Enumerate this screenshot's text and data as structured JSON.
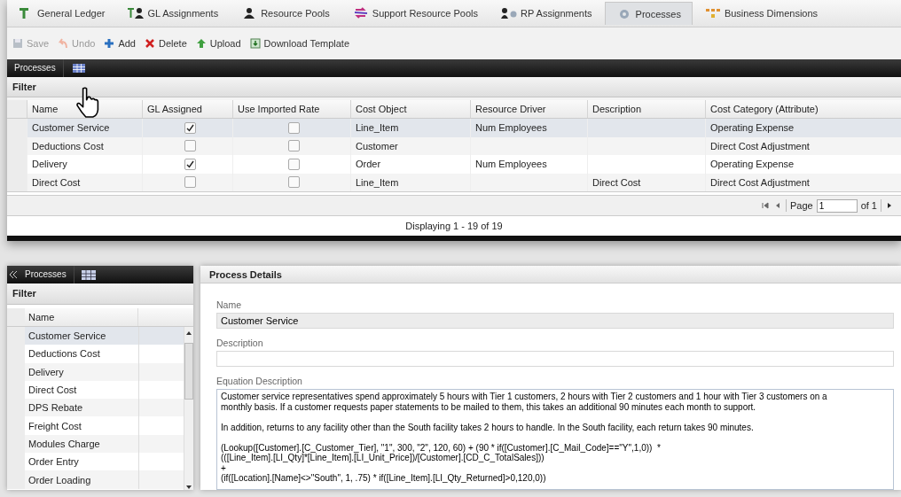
{
  "tabs": [
    {
      "label": "General Ledger",
      "selected": false
    },
    {
      "label": "GL Assignments",
      "selected": false
    },
    {
      "label": "Resource Pools",
      "selected": false
    },
    {
      "label": "Support Resource Pools",
      "selected": false
    },
    {
      "label": "RP Assignments",
      "selected": false
    },
    {
      "label": "Processes",
      "selected": true
    },
    {
      "label": "Business Dimensions",
      "selected": false
    }
  ],
  "toolbar": [
    {
      "label": "Save",
      "disabled": true
    },
    {
      "label": "Undo",
      "disabled": true
    },
    {
      "label": "Add",
      "disabled": false
    },
    {
      "label": "Delete",
      "disabled": false
    },
    {
      "label": "Upload",
      "disabled": false
    },
    {
      "label": "Download Template",
      "disabled": false
    }
  ],
  "grid": {
    "title": "Processes",
    "filter": "Filter",
    "columns": [
      "Name",
      "GL Assigned",
      "Use Imported Rate",
      "Cost Object",
      "Resource Driver",
      "Description",
      "Cost Category (Attribute)"
    ],
    "rows": [
      {
        "name": "Customer Service",
        "gl_assigned": true,
        "use_imported_rate": false,
        "cost_object": "Line_Item",
        "resource_driver": "Num Employees",
        "cost_category": "Operating Expense",
        "selected": true
      },
      {
        "name": "Deductions Cost",
        "gl_assigned": false,
        "use_imported_rate": false,
        "cost_object": "Customer",
        "cost_category": "Direct Cost Adjustment",
        "selected": false
      },
      {
        "name": "Delivery",
        "gl_assigned": true,
        "use_imported_rate": false,
        "cost_object": "Order",
        "resource_driver": "Num Employees",
        "cost_category": "Operating Expense",
        "selected": false
      },
      {
        "name": "Direct Cost",
        "gl_assigned": false,
        "use_imported_rate": false,
        "cost_object": "Line_Item",
        "description": "Direct Cost",
        "cost_category": "Direct Cost Adjustment",
        "selected": false
      }
    ],
    "pager": {
      "page_label": "Page",
      "page": "1",
      "of": "of 1"
    },
    "status": "Displaying 1 - 19 of 19"
  },
  "list": {
    "title": "Processes",
    "filter": "Filter",
    "column": "Name",
    "items": [
      {
        "name": "Customer Service",
        "selected": true
      },
      {
        "name": "Deductions Cost",
        "selected": false
      },
      {
        "name": "Delivery",
        "selected": false
      },
      {
        "name": "Direct Cost",
        "selected": false
      },
      {
        "name": "DPS Rebate",
        "selected": false
      },
      {
        "name": "Freight Cost",
        "selected": false
      },
      {
        "name": "Modules Charge",
        "selected": false
      },
      {
        "name": "Order Entry",
        "selected": false
      },
      {
        "name": "Order Loading",
        "selected": false
      }
    ]
  },
  "details": {
    "title": "Process Details",
    "fields": [
      {
        "label": "Name",
        "value": "Customer Service",
        "disabled": true,
        "kind": "line"
      },
      {
        "label": "Description",
        "disabled": false,
        "kind": "line"
      },
      {
        "label": "Equation Description",
        "value": "Customer service representatives spend approximately 5 hours with Tier 1 customers, 2 hours with Tier 2 customers and 1 hour with Tier 3 customers on a monthly basis. If a customer requests paper statements to be mailed to them, this takes an additional 90 minutes each month to support.\n\nIn addition, returns to any facility other than the South facility takes 2 hours to handle. In the South facility, each return takes 90 minutes.\n\n(Lookup([Customer].[C_Customer_Tier], \"1\", 300, \"2\", 120, 60) + (90 * if([Customer].[C_Mail_Code]==\"Y\",1,0))  *\n(([Line_Item].[LI_Qty]*[Line_Item].[LI_Unit_Price])/[Customer].[CD_C_TotalSales]))\n+\n(if([Location].[Name]<>\"South\", 1, .75) * if([Line_Item].[LI_Qty_Returned]>0,120,0))",
        "disabled": false,
        "kind": "area"
      }
    ]
  }
}
